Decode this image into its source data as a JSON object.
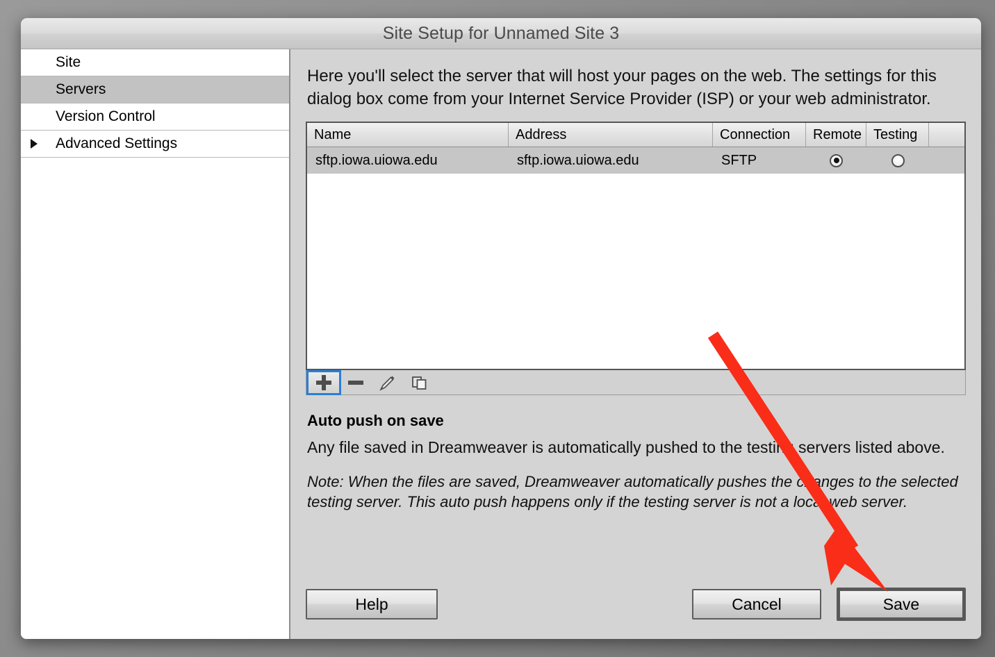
{
  "window": {
    "title": "Site Setup for Unnamed Site 3"
  },
  "sidebar": {
    "items": [
      {
        "label": "Site",
        "selected": false,
        "disclosure": false
      },
      {
        "label": "Servers",
        "selected": true,
        "disclosure": false
      },
      {
        "label": "Version Control",
        "selected": false,
        "disclosure": false
      },
      {
        "label": "Advanced Settings",
        "selected": false,
        "disclosure": true
      }
    ]
  },
  "main": {
    "intro": "Here you'll select the server that will host your pages on the web. The settings for this dialog box come from your Internet Service Provider (ISP) or your web administrator.",
    "table": {
      "columns": [
        "Name",
        "Address",
        "Connection",
        "Remote",
        "Testing"
      ],
      "rows": [
        {
          "name": "sftp.iowa.uiowa.edu",
          "address": "sftp.iowa.uiowa.edu",
          "connection": "SFTP",
          "remote": true,
          "testing": false,
          "selected": true
        }
      ]
    },
    "toolbar": {
      "add_label": "+",
      "remove_label": "−",
      "edit_label": "edit",
      "duplicate_label": "duplicate",
      "focused": "add-server-button"
    },
    "auto_push": {
      "heading": "Auto push on save",
      "body": " Any file saved in Dreamweaver is automatically pushed to the testing servers listed above.",
      "note": "Note: When the files are saved, Dreamweaver automatically pushes the changes to the selected testing server. This auto push happens only if the testing server is not a local web server."
    }
  },
  "footer": {
    "help_label": "Help",
    "cancel_label": "Cancel",
    "save_label": "Save"
  },
  "annotation": {
    "arrow_color": "#f92d18",
    "points_to": "save-button"
  },
  "colors": {
    "focus_ring": "#2a7fd4",
    "selection": "#c2c2c2",
    "dialog_bg": "#d4d4d4"
  }
}
